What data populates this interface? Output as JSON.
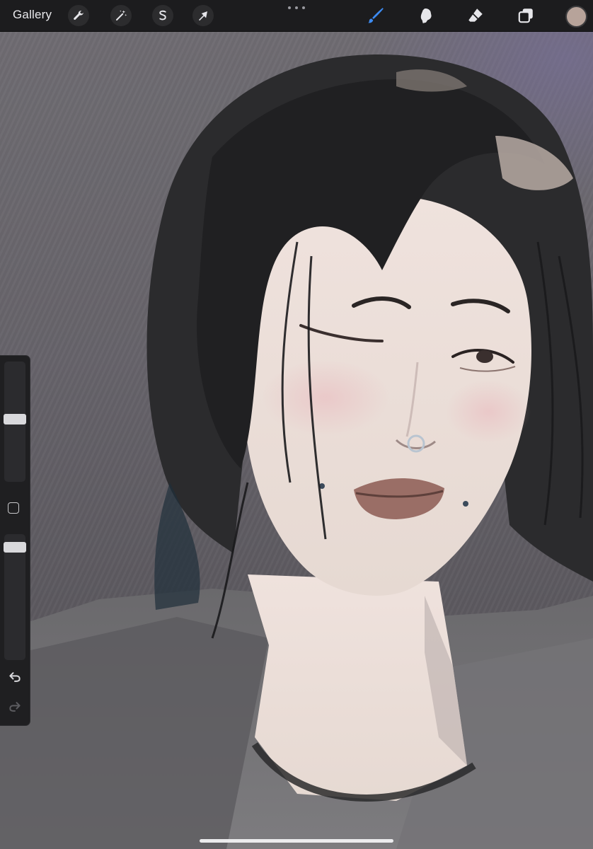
{
  "toolbar": {
    "gallery_label": "Gallery",
    "left_tools": [
      {
        "name": "actions",
        "icon": "wrench-icon"
      },
      {
        "name": "adjustments",
        "icon": "magic-wand-icon"
      },
      {
        "name": "selection",
        "icon": "selection-s-icon"
      },
      {
        "name": "transform",
        "icon": "arrow-cursor-icon"
      }
    ],
    "right_tools": [
      {
        "name": "brush",
        "icon": "brush-icon",
        "active": true
      },
      {
        "name": "smudge",
        "icon": "smudge-finger-icon",
        "active": false
      },
      {
        "name": "eraser",
        "icon": "eraser-icon",
        "active": false
      },
      {
        "name": "layers",
        "icon": "layers-icon",
        "active": false
      }
    ],
    "active_tool_color": "#3d8bf2",
    "current_color": "#b7a39a"
  },
  "sidebar": {
    "brush_size": 0.52,
    "opacity": 0.93,
    "undo_icon": "undo-arrow-icon",
    "redo_icon": "redo-arrow-icon"
  },
  "canvas": {
    "background_color": "#68656c",
    "accent_color": "#7c74a0"
  }
}
